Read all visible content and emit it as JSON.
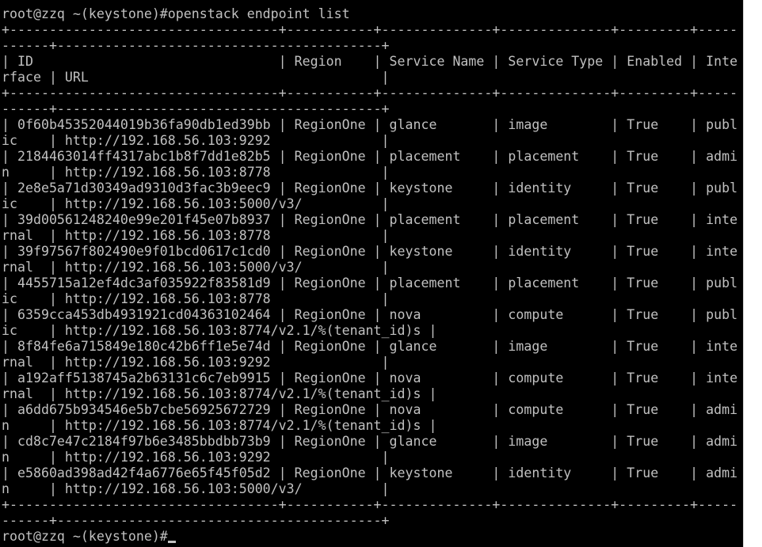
{
  "terminal": {
    "prompt_command": "root@zzq ~(keystone)#openstack endpoint list",
    "border_top_1": "+----------------------------------+-----------+--------------+--------------+---------+-----",
    "border_top_2": "------+-----------------------------------------+",
    "header_1": "| ID                               | Region    | Service Name | Service Type | Enabled | Inte",
    "header_2": "rface | URL                                     |",
    "border_mid_1": "+----------------------------------+-----------+--------------+--------------+---------+-----",
    "border_mid_2": "------+-----------------------------------------+",
    "rows": [
      {
        "line1": "| 0f60b45352044019b36fa90db1ed39bb | RegionOne | glance       | image        | True    | publ",
        "line2": "ic    | http://192.168.56.103:9292              |"
      },
      {
        "line1": "| 2184463014ff4317abc1b8f7dd1e82b5 | RegionOne | placement    | placement    | True    | admi",
        "line2": "n     | http://192.168.56.103:8778              |"
      },
      {
        "line1": "| 2e8e5a71d30349ad9310d3fac3b9eec9 | RegionOne | keystone     | identity     | True    | publ",
        "line2": "ic    | http://192.168.56.103:5000/v3/          |"
      },
      {
        "line1": "| 39d00561248240e99e201f45e07b8937 | RegionOne | placement    | placement    | True    | inte",
        "line2": "rnal  | http://192.168.56.103:8778              |"
      },
      {
        "line1": "| 39f97567f802490e9f01bcd0617c1cd0 | RegionOne | keystone     | identity     | True    | inte",
        "line2": "rnal  | http://192.168.56.103:5000/v3/          |"
      },
      {
        "line1": "| 4455715a12ef4dc3af035922f83581d9 | RegionOne | placement    | placement    | True    | publ",
        "line2": "ic    | http://192.168.56.103:8778              |"
      },
      {
        "line1": "| 6359cca453db4931921cd04363102464 | RegionOne | nova         | compute      | True    | publ",
        "line2": "ic    | http://192.168.56.103:8774/v2.1/%(tenant_id)s |"
      },
      {
        "line1": "| 8f84fe6a715849e180c42b6ff1e5e74d | RegionOne | glance       | image        | True    | inte",
        "line2": "rnal  | http://192.168.56.103:9292              |"
      },
      {
        "line1": "| a192aff5138745a2b63131c6c7eb9915 | RegionOne | nova         | compute      | True    | inte",
        "line2": "rnal  | http://192.168.56.103:8774/v2.1/%(tenant_id)s |"
      },
      {
        "line1": "| a6dd675b934546e5b7cbe56925672729 | RegionOne | nova         | compute      | True    | admi",
        "line2": "n     | http://192.168.56.103:8774/v2.1/%(tenant_id)s |"
      },
      {
        "line1": "| cd8c7e47c2184f97b6e3485bbdbb73b9 | RegionOne | glance       | image        | True    | admi",
        "line2": "n     | http://192.168.56.103:9292              |"
      },
      {
        "line1": "| e5860ad398ad42f4a6776e65f45f05d2 | RegionOne | keystone     | identity     | True    | admi",
        "line2": "n     | http://192.168.56.103:5000/v3/          |"
      }
    ],
    "border_bot_1": "+----------------------------------+-----------+--------------+--------------+---------+-----",
    "border_bot_2": "------+-----------------------------------------+",
    "final_prompt": "root@zzq ~(keystone)#"
  },
  "colors": {
    "background": "#000000",
    "foreground": "#c0c0c0",
    "scrollbar": "#ffffff"
  }
}
